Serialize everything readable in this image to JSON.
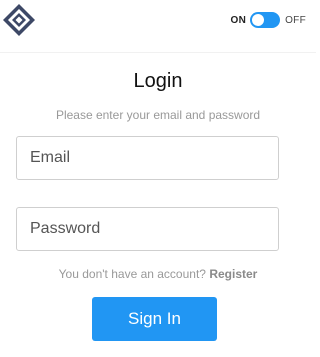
{
  "header": {
    "logo_icon": "diamond-logo-icon",
    "toggle": {
      "on_label": "ON",
      "off_label": "OFF",
      "state": "on",
      "accent_color": "#2196f3"
    }
  },
  "login": {
    "title": "Login",
    "subtitle": "Please enter your email and password",
    "email": {
      "placeholder": "Email",
      "value": ""
    },
    "password": {
      "placeholder": "Password",
      "value": ""
    },
    "register_prompt": "You don't have an account?",
    "register_link": "Register",
    "signin_label": "Sign In",
    "button_color": "#2196f3"
  }
}
